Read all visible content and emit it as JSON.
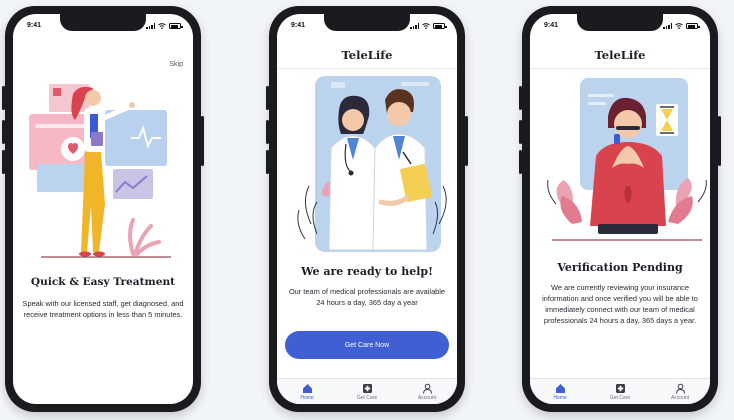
{
  "status": {
    "time": "9:41"
  },
  "screen1": {
    "skip_label": "Skip",
    "heading": "Quick & Easy Treatment",
    "body": "Speak with our licensed staff, get diagnosed, and receive treatment options in less than 5 minutes."
  },
  "screen2": {
    "app_title": "TeleLife",
    "heading": "We are ready to help!",
    "body": "Our team of medical professionals are available 24 hours a day, 365 day a year",
    "cta_label": "Get Care Now",
    "tabs": [
      {
        "label": "Home",
        "icon": "home-icon"
      },
      {
        "label": "Get Care",
        "icon": "medical-cross-icon"
      },
      {
        "label": "Account",
        "icon": "user-icon"
      }
    ]
  },
  "screen3": {
    "app_title": "TeleLife",
    "heading": "Verification Pending",
    "body": "We are currently reviewing your insurance information and once verified you will be able to immediately connect with our team of medical professionals 24 hours a day, 365 days a year.",
    "tabs": [
      {
        "label": "Home",
        "icon": "home-icon"
      },
      {
        "label": "Get Care",
        "icon": "medical-cross-icon"
      },
      {
        "label": "Account",
        "icon": "user-icon"
      }
    ]
  },
  "colors": {
    "accent": "#3f5fd2",
    "illustration_pink": "#e9a3b3",
    "illustration_blue": "#bcd3ee",
    "illustration_red": "#d9434d"
  }
}
